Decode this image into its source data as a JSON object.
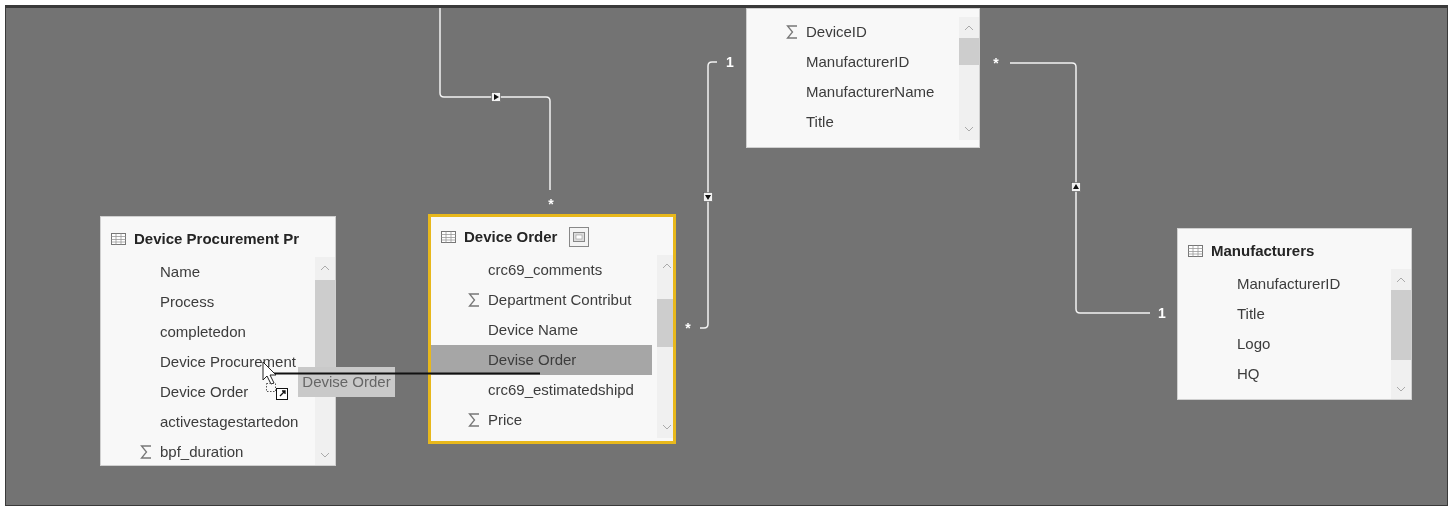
{
  "tables": [
    {
      "title": "Device Procurement Pr",
      "selected": false,
      "fields": [
        {
          "name": "Name",
          "sum": false,
          "selected": false
        },
        {
          "name": "Process",
          "sum": false,
          "selected": false
        },
        {
          "name": "completedon",
          "sum": false,
          "selected": false
        },
        {
          "name": "Device Procurement",
          "sum": false,
          "selected": false
        },
        {
          "name": "Device Order",
          "sum": false,
          "selected": false
        },
        {
          "name": "activestagestartedon",
          "sum": false,
          "selected": false
        },
        {
          "name": "bpf_duration",
          "sum": true,
          "selected": false
        }
      ]
    },
    {
      "title": "Device Order",
      "selected": true,
      "fields": [
        {
          "name": "crc69_comments",
          "sum": false,
          "selected": false
        },
        {
          "name": "Department Contribut",
          "sum": true,
          "selected": false
        },
        {
          "name": "Device Name",
          "sum": false,
          "selected": false
        },
        {
          "name": "Devise Order",
          "sum": false,
          "selected": true
        },
        {
          "name": "crc69_estimatedshipd",
          "sum": false,
          "selected": false
        },
        {
          "name": "Price",
          "sum": true,
          "selected": false
        }
      ]
    },
    {
      "selected": false,
      "fields": [
        {
          "name": "DeviceID",
          "sum": true,
          "selected": false
        },
        {
          "name": "ManufacturerID",
          "sum": false,
          "selected": false
        },
        {
          "name": "ManufacturerName",
          "sum": false,
          "selected": false
        },
        {
          "name": "Title",
          "sum": false,
          "selected": false
        }
      ]
    },
    {
      "title": "Manufacturers",
      "selected": false,
      "fields": [
        {
          "name": "ManufacturerID",
          "sum": false,
          "selected": false
        },
        {
          "name": "Title",
          "sum": false,
          "selected": false
        },
        {
          "name": "Logo",
          "sum": false,
          "selected": false
        },
        {
          "name": "HQ",
          "sum": false,
          "selected": false
        }
      ]
    }
  ],
  "relationships": [
    {
      "labels": [
        "*"
      ]
    },
    {
      "labels": [
        "1",
        "*"
      ]
    },
    {
      "labels": [
        "*",
        "1"
      ]
    }
  ],
  "drag_tooltip": "Devise Order"
}
